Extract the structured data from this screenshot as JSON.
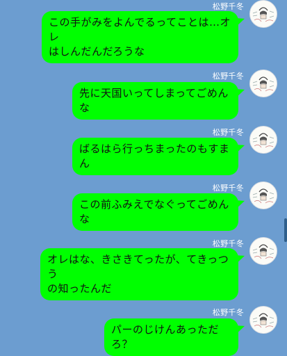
{
  "chat": {
    "messages": [
      {
        "sender": "松野千冬",
        "text": "この手がみをよんでるってことは…オレ\nはしんだんだろうな"
      },
      {
        "sender": "松野千冬",
        "text": "先に天国いってしまってごめんな"
      },
      {
        "sender": "松野千冬",
        "text": "ばるはら行っちまったのもすまん"
      },
      {
        "sender": "松野千冬",
        "text": "この前ふみえでなぐってごめんな"
      },
      {
        "sender": "松野千冬",
        "text": "オレはな、きさきてったが、てきっつう\nの知ったんだ"
      },
      {
        "sender": "松野千冬",
        "text": "パーのじけんあっただろ？"
      }
    ]
  },
  "colors": {
    "background": "#6c9dd0",
    "bubble": "#00ff00",
    "sender_text": "#ffffff"
  },
  "icons": {
    "avatar": "avatar-sketch-icon"
  }
}
